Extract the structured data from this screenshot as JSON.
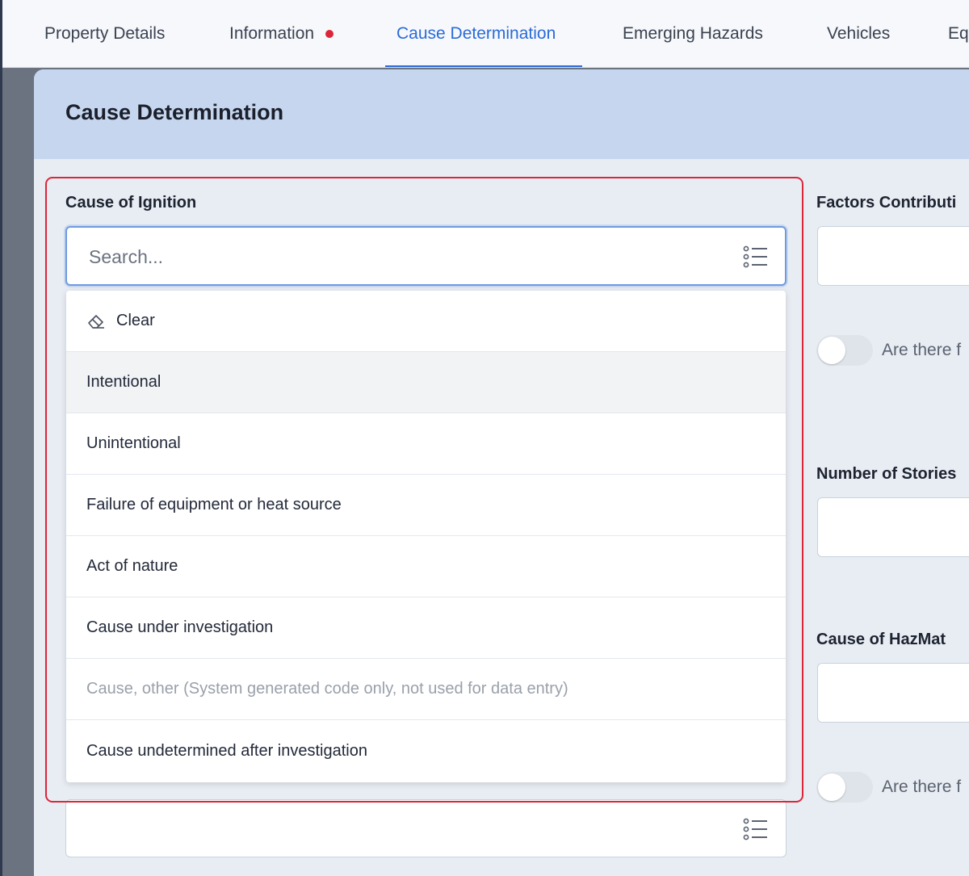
{
  "tabs": [
    {
      "label": "Property Details",
      "alert": false,
      "active": false
    },
    {
      "label": "Information",
      "alert": true,
      "active": false
    },
    {
      "label": "Cause Determination",
      "alert": false,
      "active": true
    },
    {
      "label": "Emerging Hazards",
      "alert": false,
      "active": false
    },
    {
      "label": "Vehicles",
      "alert": false,
      "active": false
    },
    {
      "label": "Eq",
      "alert": false,
      "active": false
    }
  ],
  "colors": {
    "accent": "#2a6bd9",
    "alert_dot": "#dc2638",
    "highlight": "#dc2638"
  },
  "section": {
    "title": "Cause Determination"
  },
  "cause_of_ignition": {
    "label": "Cause of Ignition",
    "placeholder": "Search...",
    "value": "",
    "icon": "list-icon",
    "clear_label": "Clear",
    "clear_icon": "eraser-icon",
    "options": [
      {
        "label": "Intentional",
        "disabled": false,
        "hovered": true
      },
      {
        "label": "Unintentional",
        "disabled": false,
        "hovered": false
      },
      {
        "label": "Failure of equipment or heat source",
        "disabled": false,
        "hovered": false
      },
      {
        "label": "Act of nature",
        "disabled": false,
        "hovered": false
      },
      {
        "label": "Cause under investigation",
        "disabled": false,
        "hovered": false
      },
      {
        "label": "Cause, other (System generated code only, not used for data entry)",
        "disabled": true,
        "hovered": false
      },
      {
        "label": "Cause undetermined after investigation",
        "disabled": false,
        "hovered": false
      }
    ]
  },
  "right_column": {
    "factors_label": "Factors Contributi",
    "toggle1_label": "Are there f",
    "toggle1_on": false,
    "stories_label": "Number of Stories",
    "hazmat_label": "Cause of HazMat",
    "toggle2_label": "Are there f",
    "toggle2_on": false
  }
}
